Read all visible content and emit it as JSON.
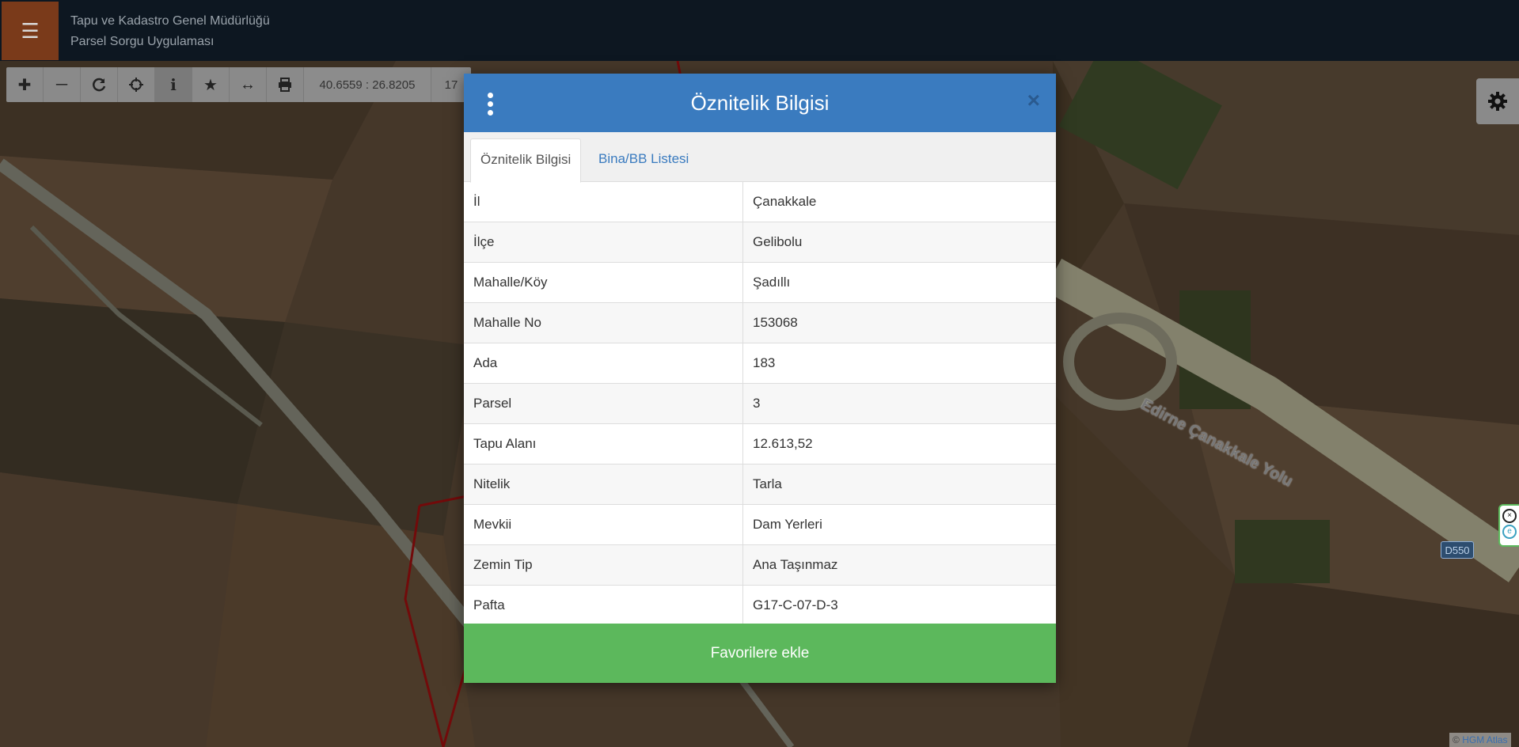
{
  "header": {
    "org": "Tapu ve Kadastro Genel Müdürlüğü",
    "app": "Parsel Sorgu Uygulaması"
  },
  "toolbar": {
    "coordinates": "40.6559 : 26.8205",
    "scale": "17"
  },
  "map": {
    "road_name": "Edirne Çanakkale Yolu",
    "road_sign": "D550",
    "attribution_prefix": "©",
    "attribution_link": "HGM Atlas"
  },
  "modal": {
    "title": "Öznitelik Bilgisi",
    "close": "×",
    "tabs": [
      "Öznitelik Bilgisi",
      "Bina/BB Listesi"
    ],
    "rows": [
      {
        "key": "İl",
        "value": "Çanakkale"
      },
      {
        "key": "İlçe",
        "value": "Gelibolu"
      },
      {
        "key": "Mahalle/Köy",
        "value": "Şadıllı"
      },
      {
        "key": "Mahalle No",
        "value": "153068"
      },
      {
        "key": "Ada",
        "value": "183"
      },
      {
        "key": "Parsel",
        "value": "3"
      },
      {
        "key": "Tapu Alanı",
        "value": "12.613,52"
      },
      {
        "key": "Nitelik",
        "value": "Tarla"
      },
      {
        "key": "Mevkii",
        "value": "Dam Yerleri"
      },
      {
        "key": "Zemin Tip",
        "value": "Ana Taşınmaz"
      },
      {
        "key": "Pafta",
        "value": "G17-C-07-D-3"
      }
    ],
    "favorite_button": "Favorilere ekle"
  },
  "colors": {
    "header_bg": "#0d1721",
    "modal_header": "#3a7bbf",
    "favorite_button": "#5cb85c",
    "parcel_outline": "#b01010"
  }
}
